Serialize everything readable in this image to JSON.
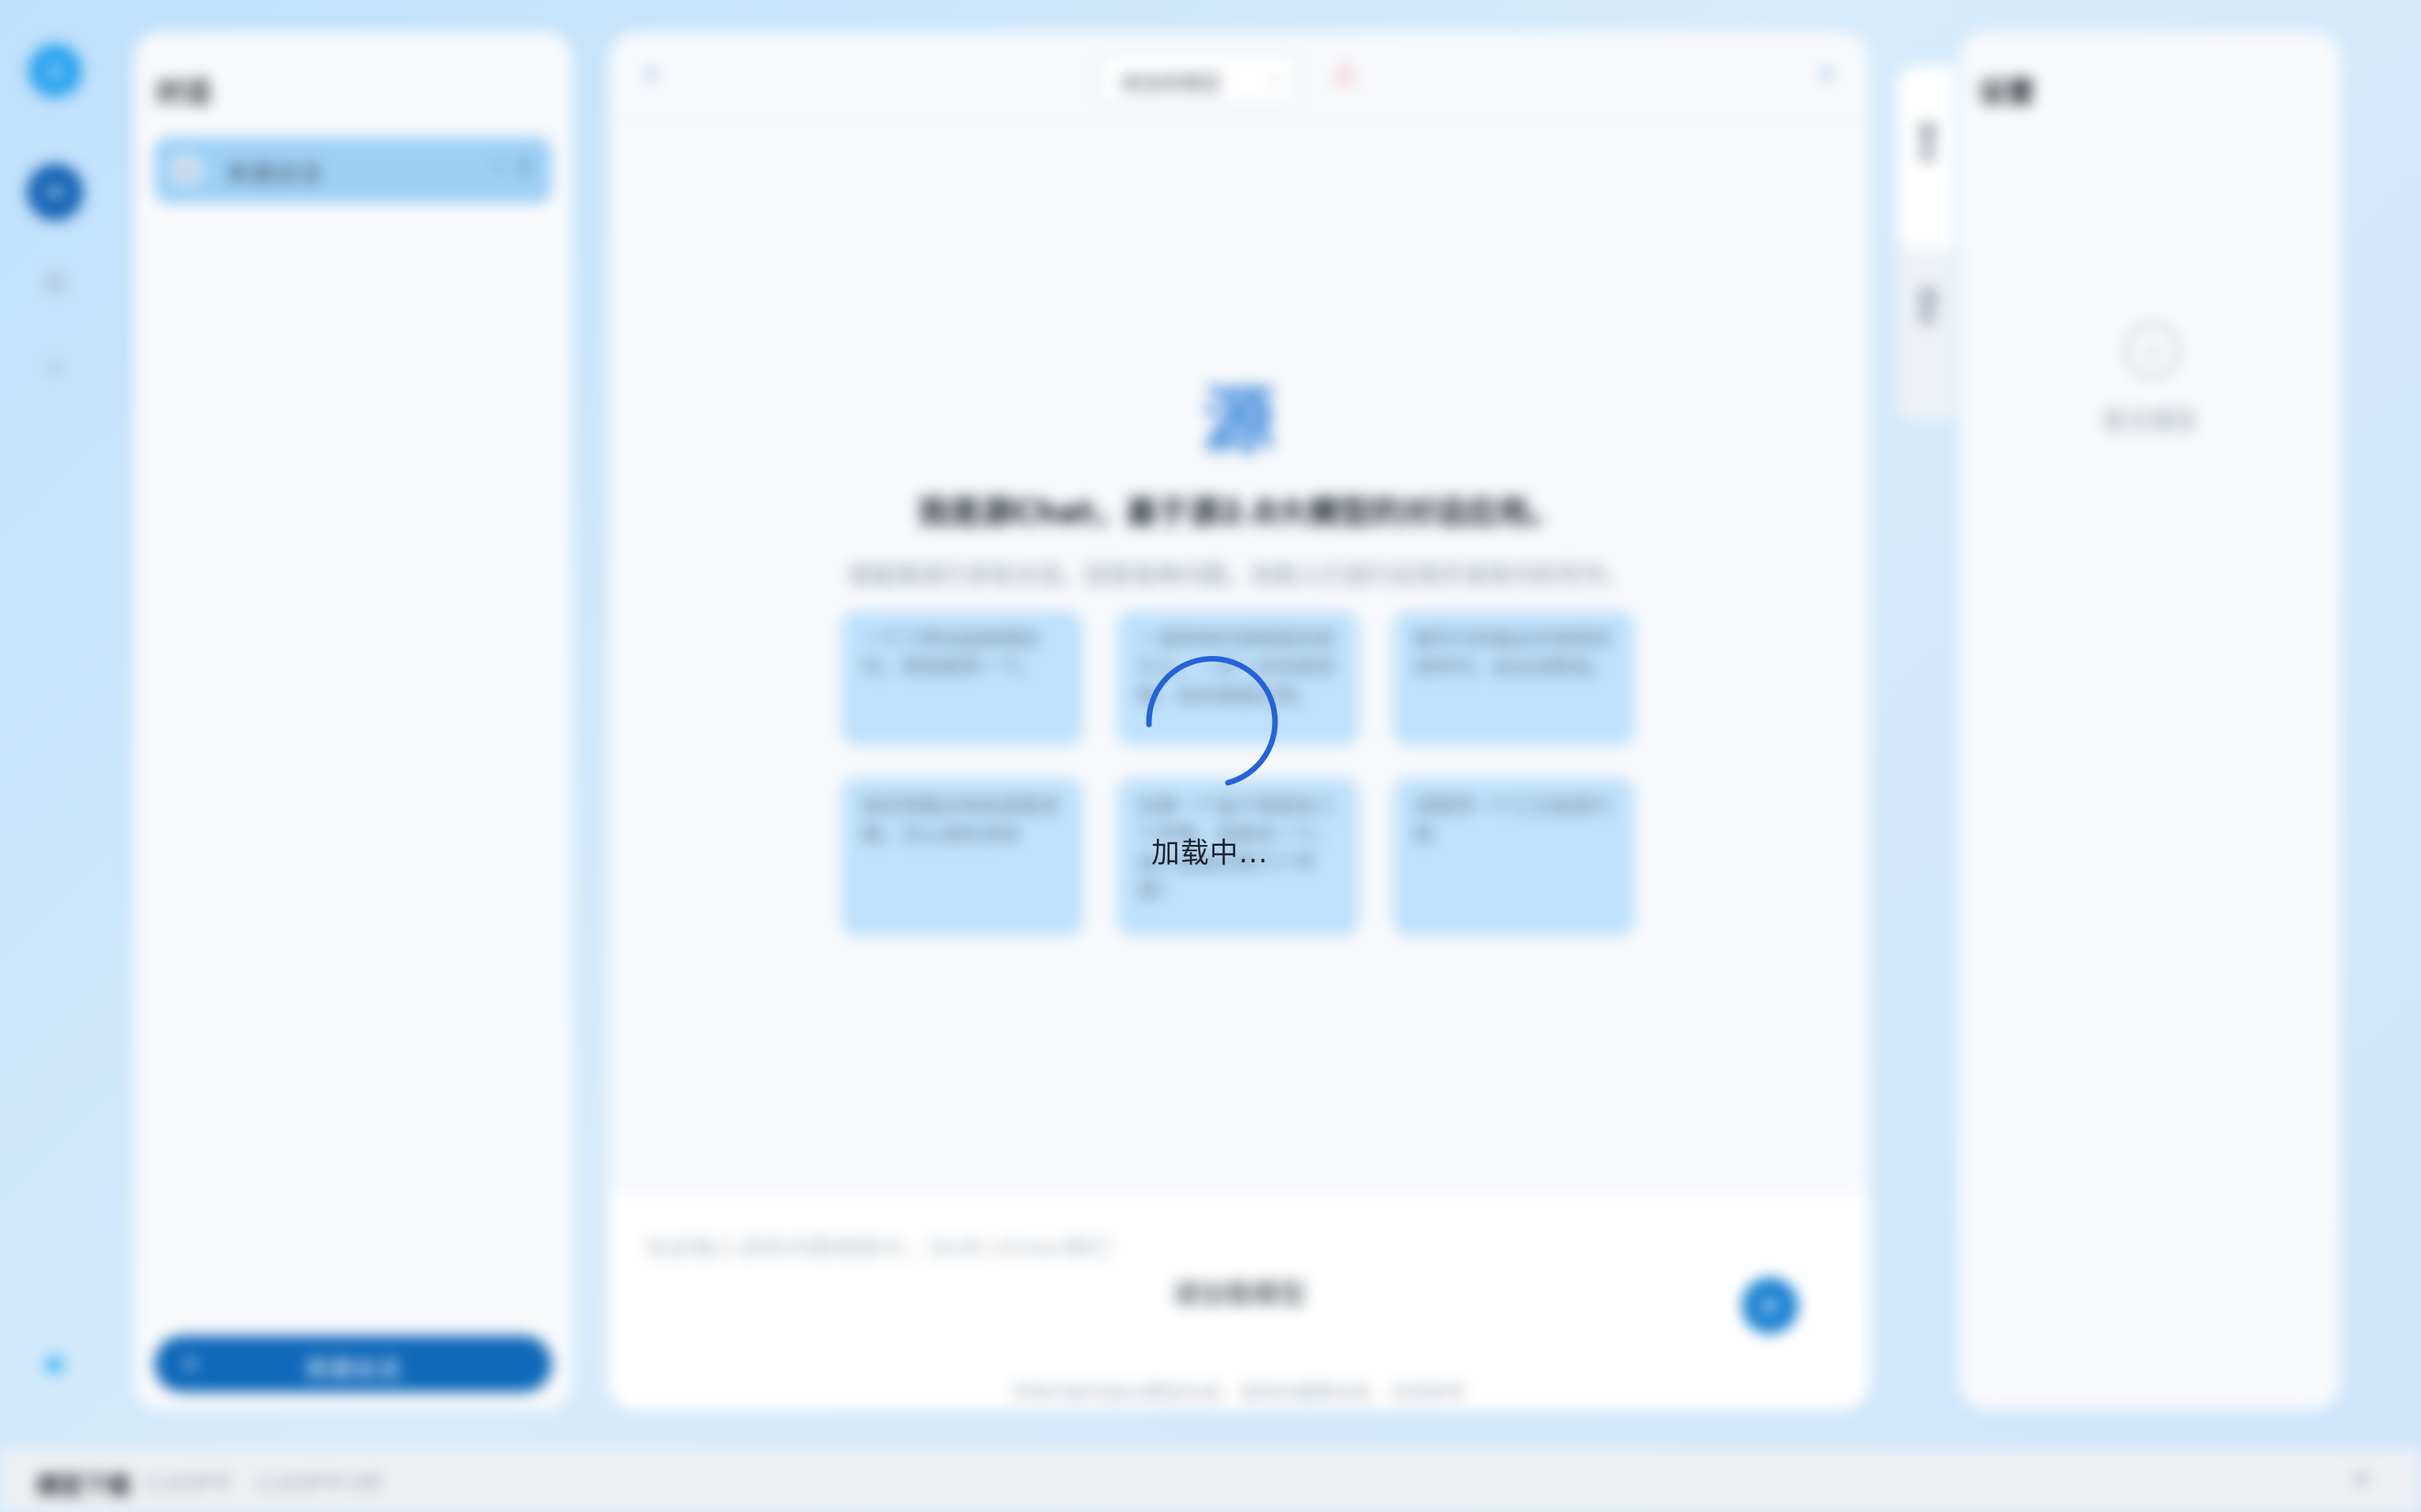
{
  "nav": {
    "avatar_letter": "A",
    "chat_icon": "chat-icon",
    "icons": [
      "grid-icon",
      "settings-icon"
    ]
  },
  "conversations": {
    "title": "对话",
    "items": [
      {
        "label": "新建会话",
        "edit_icon": "edit-icon",
        "delete_icon": "trash-icon"
      }
    ],
    "new_button_label": "新建会话"
  },
  "main": {
    "model_select_value": "请选择模型",
    "hero_logo_glyph": "源",
    "title": "我是源Chat，基于源2.0大模型的对话应用。",
    "subtitle": "我能够进行多轮对话，回答各种问题，协助人们进行应用开发和代码写作。",
    "suggestions": [
      "一个三明治能做哪些吗，帮我推荐一下。",
      "一道简单的高数题目是什么，一步一步给我讲解，给你做题应用。",
      "编写代码输出并按规则排序列，给出该数组。",
      "我觉得最近有些疲惫烦躁，怎么放松身体",
      "如果一个盒子里面有三个苹果，我拿走一个，盒子里面还剩几个苹果？",
      "请推荐一个三日旅游行程"
    ],
    "input_placeholder": "在此输入您的问题或指令，Shift+Enter换行",
    "input_hint": "请加载模型",
    "footer_note": "所有内容均由AI模型生成，请核实重要信息，仅供参考"
  },
  "side_tabs": [
    "模型",
    "插件"
  ],
  "settings": {
    "title": "设置",
    "empty_icon": "cube-icon",
    "empty_text": "暂无模型"
  },
  "status_bar": {
    "title": "模型下载",
    "metrics": [
      "0.00字节",
      "0.00字节",
      "0项"
    ]
  },
  "loading": {
    "text": "加载中..."
  },
  "colors": {
    "accent": "#1463b5",
    "spinner": "#2563d9",
    "background": "#cfe6fb"
  }
}
